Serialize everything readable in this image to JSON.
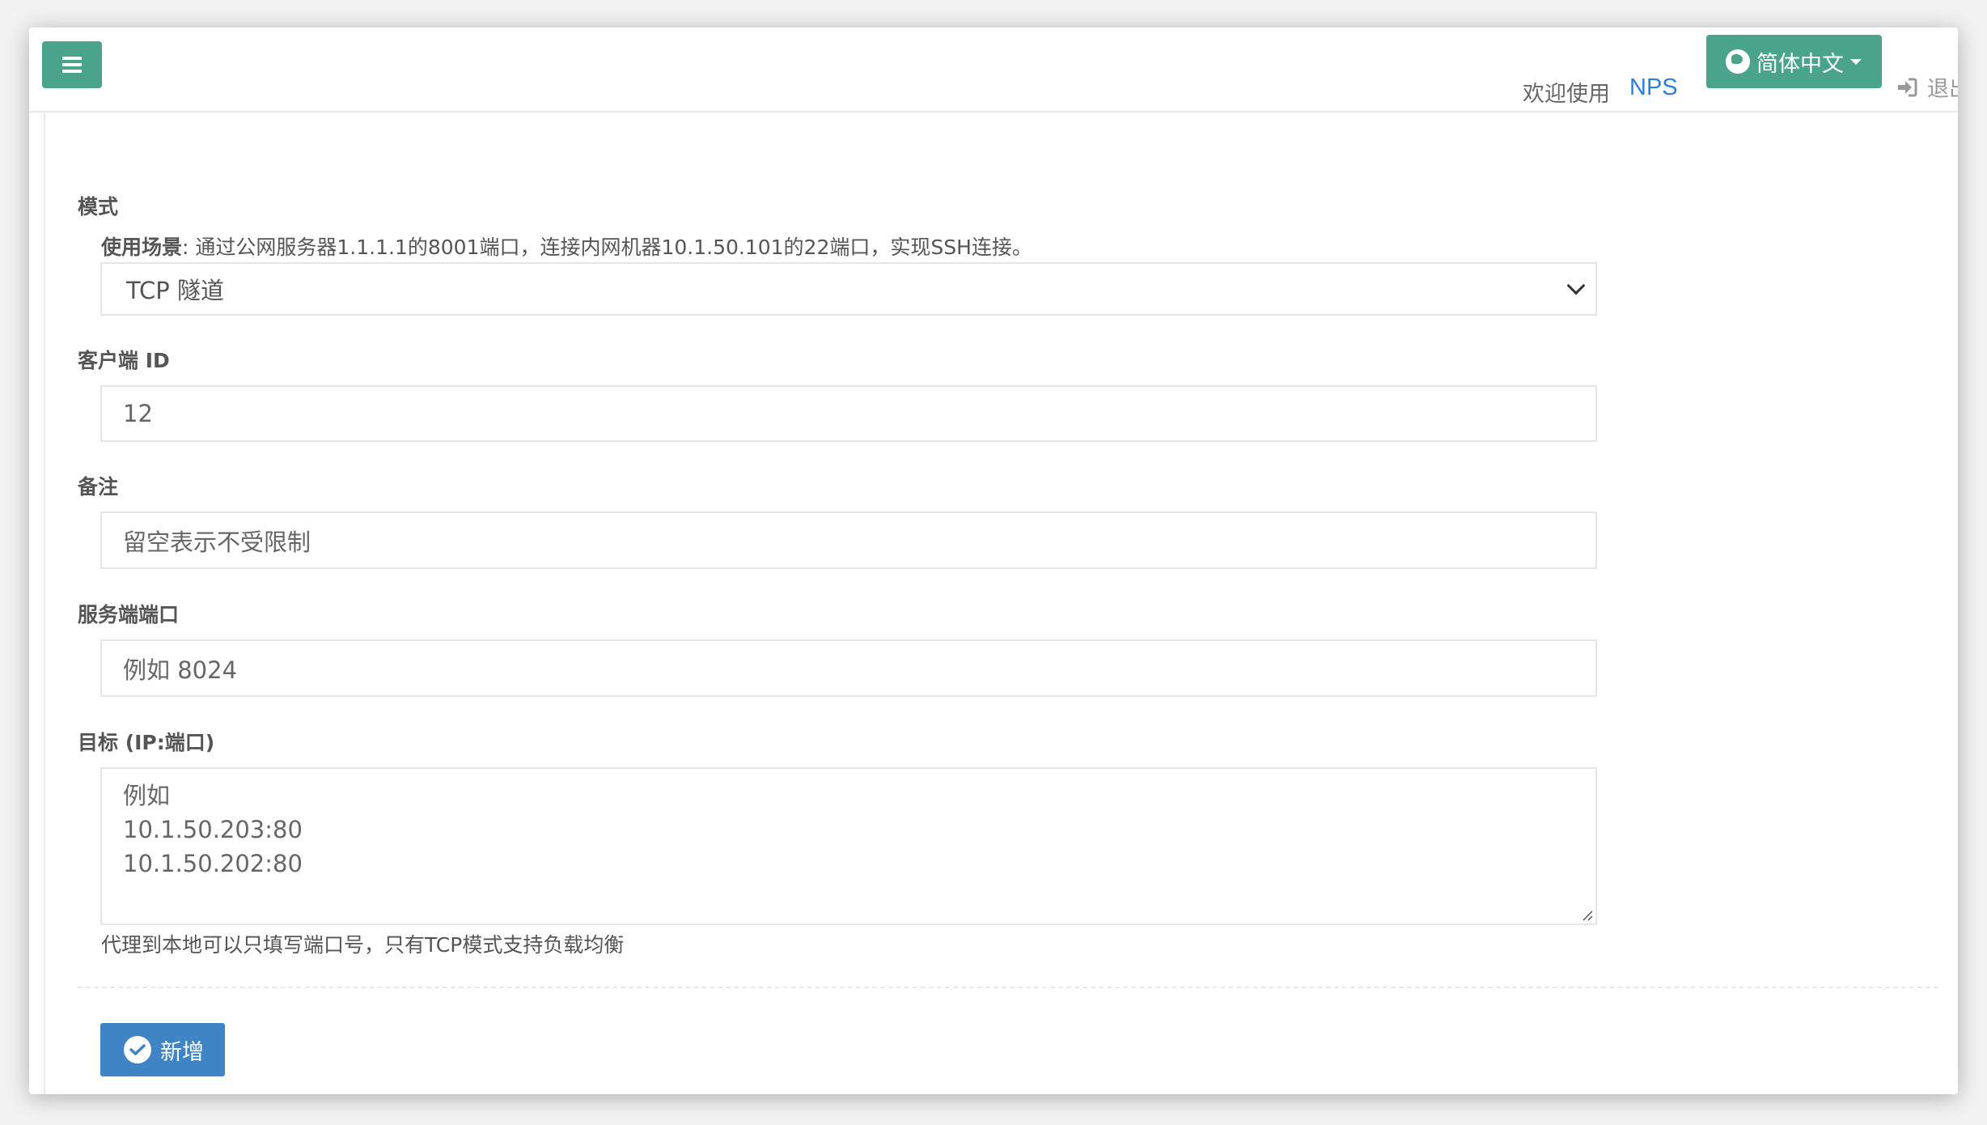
{
  "header": {
    "welcome_text": "欢迎使用",
    "brand": "NPS",
    "language": "简体中文",
    "logout_label": "退出"
  },
  "form": {
    "mode": {
      "label": "模式",
      "scenario_title": "使用场景",
      "scenario_text": ": 通过公网服务器1.1.1.1的8001端口，连接内网机器10.1.50.101的22端口，实现SSH连接。",
      "selected": "TCP 隧道"
    },
    "client_id": {
      "label": "客户端 ID",
      "value": "12"
    },
    "remark": {
      "label": "备注",
      "placeholder": "留空表示不受限制"
    },
    "server_port": {
      "label": "服务端端口",
      "placeholder": "例如 8024"
    },
    "target": {
      "label": "目标 (IP:端口)",
      "placeholder": "例如\n10.1.50.203:80\n10.1.50.202:80",
      "help": "代理到本地可以只填写端口号，只有TCP模式支持负载均衡"
    },
    "submit_label": "新增"
  },
  "colors": {
    "primary_green": "#4aa48b",
    "link_blue": "#2f7ed8",
    "submit_blue": "#3f84c4"
  }
}
